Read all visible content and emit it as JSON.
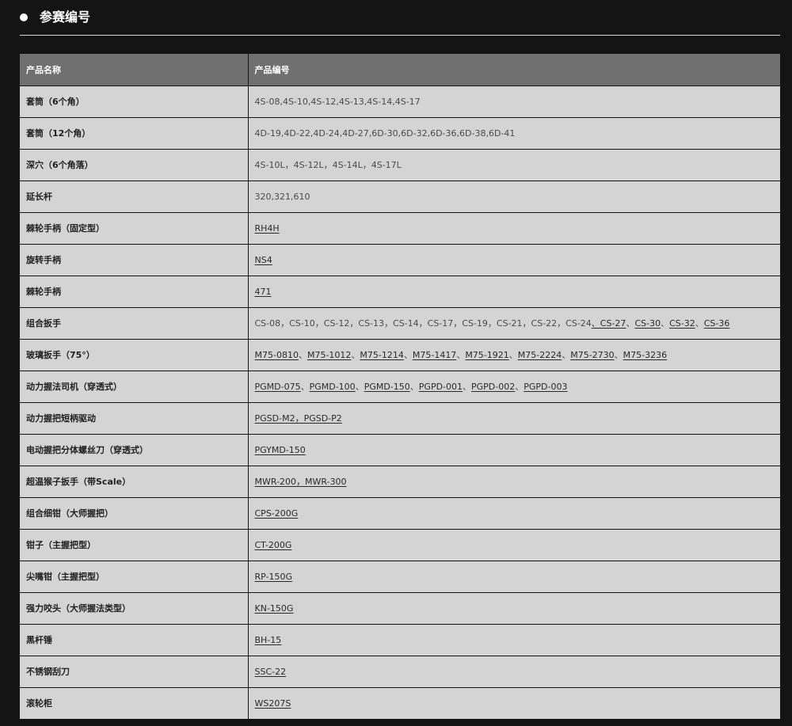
{
  "section": {
    "title": "参赛编号"
  },
  "table": {
    "headers": [
      "产品名称",
      "产品编号"
    ],
    "rows": [
      {
        "name": "套筒（6个角）",
        "parts": [
          {
            "text": "4S-08,4S-10,4S-12,4S-13,4S-14,4S-17",
            "link": false
          }
        ]
      },
      {
        "name": "套筒（12个角）",
        "parts": [
          {
            "text": "4D-19,4D-22,4D-24,4D-27,6D-30,6D-32,6D-36,6D-38,6D-41",
            "link": false
          }
        ]
      },
      {
        "name": "深穴（6个角落）",
        "parts": [
          {
            "text": "4S-10L，4S-12L，4S-14L，4S-17L",
            "link": false
          }
        ]
      },
      {
        "name": "延长杆",
        "parts": [
          {
            "text": "320,321,610",
            "link": false
          }
        ]
      },
      {
        "name": "棘轮手柄（固定型）",
        "parts": [
          {
            "text": "RH4H",
            "link": true
          }
        ]
      },
      {
        "name": "旋转手柄",
        "parts": [
          {
            "text": "NS4",
            "link": true
          }
        ]
      },
      {
        "name": "棘轮手柄",
        "parts": [
          {
            "text": "471",
            "link": true
          }
        ]
      },
      {
        "name": "组合扳手",
        "parts": [
          {
            "text": "CS-08，CS-10，CS-12，CS-13，CS-14，CS-17，CS-19，CS-21，CS-22，CS-24",
            "link": false
          },
          {
            "text": "、CS-27",
            "link": true
          },
          {
            "text": "、",
            "link": false
          },
          {
            "text": "CS-30",
            "link": true
          },
          {
            "text": "、",
            "link": false
          },
          {
            "text": "CS-32",
            "link": true
          },
          {
            "text": "、",
            "link": false
          },
          {
            "text": "CS-36",
            "link": true
          }
        ]
      },
      {
        "name": "玻璃扳手（75°）",
        "parts": [
          {
            "text": "M75-0810",
            "link": true
          },
          {
            "text": "、",
            "link": false
          },
          {
            "text": "M75-1012",
            "link": true
          },
          {
            "text": "、",
            "link": false
          },
          {
            "text": "M75-1214",
            "link": true
          },
          {
            "text": "、",
            "link": false
          },
          {
            "text": "M75-1417",
            "link": true
          },
          {
            "text": "、",
            "link": false
          },
          {
            "text": "M75-1921",
            "link": true
          },
          {
            "text": "、",
            "link": false
          },
          {
            "text": "M75-2224",
            "link": true
          },
          {
            "text": "、",
            "link": false
          },
          {
            "text": "M75-2730",
            "link": true
          },
          {
            "text": "、",
            "link": false
          },
          {
            "text": "M75-3236",
            "link": true
          }
        ]
      },
      {
        "name": "动力握法司机（穿透式）",
        "parts": [
          {
            "text": "PGMD-075",
            "link": true
          },
          {
            "text": "、",
            "link": false
          },
          {
            "text": "PGMD-100",
            "link": true
          },
          {
            "text": "、",
            "link": false
          },
          {
            "text": "PGMD-150",
            "link": true
          },
          {
            "text": "、",
            "link": false
          },
          {
            "text": "PGPD-001",
            "link": true
          },
          {
            "text": "、",
            "link": false
          },
          {
            "text": "PGPD-002",
            "link": true
          },
          {
            "text": "、",
            "link": false
          },
          {
            "text": "PGPD-003",
            "link": true
          }
        ]
      },
      {
        "name": "动力握把短柄驱动",
        "parts": [
          {
            "text": "PGSD-M2，PGSD-P2",
            "link": true
          }
        ]
      },
      {
        "name": "电动握把分体螺丝刀（穿透式）",
        "parts": [
          {
            "text": "PGYMD-150",
            "link": true
          }
        ]
      },
      {
        "name": "超温猴子扳手（带Scale）",
        "parts": [
          {
            "text": "MWR-200，MWR-300",
            "link": true
          }
        ]
      },
      {
        "name": "组合细钳（大师握把）",
        "parts": [
          {
            "text": "CPS-200G",
            "link": true
          }
        ]
      },
      {
        "name": "钳子（主握把型）",
        "parts": [
          {
            "text": "CT-200G",
            "link": true
          }
        ]
      },
      {
        "name": "尖嘴钳（主握把型）",
        "parts": [
          {
            "text": "RP-150G",
            "link": true
          }
        ]
      },
      {
        "name": "强力咬头（大师握法类型）",
        "parts": [
          {
            "text": "KN-150G",
            "link": true
          }
        ]
      },
      {
        "name": "黑杆锤",
        "parts": [
          {
            "text": "BH-15",
            "link": true
          }
        ]
      },
      {
        "name": "不锈钢刮刀",
        "parts": [
          {
            "text": "SSC-22",
            "link": true
          }
        ]
      },
      {
        "name": "滚轮柜",
        "parts": [
          {
            "text": "WS207S",
            "link": true
          }
        ]
      }
    ]
  },
  "colors": {
    "page_background": "#141414",
    "header_row": "#707070",
    "body_row": "#d4d4d4"
  }
}
